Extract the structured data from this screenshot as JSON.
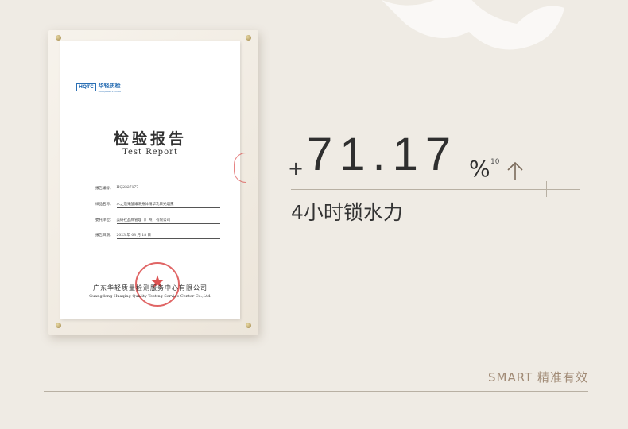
{
  "certificate": {
    "logo_mark": "HQTC",
    "logo_cn": "华轻质检",
    "logo_en": "HUAQING TESTING",
    "title_cn": "检验报告",
    "title_en": "Test Report",
    "fields": [
      {
        "label": "报告编号：",
        "value": "HQ2327177"
      },
      {
        "label": "样品名称：",
        "value": "水之蔻果酸嫩滑身体精华乳日光烟熏"
      },
      {
        "label": "委托单位：",
        "value": "美研社品牌管理（广州）有限公司"
      },
      {
        "label": "报告日期：",
        "value": "2023 年 08 月 18 日"
      }
    ],
    "company_cn": "广东华轻质量检测服务中心有限公司",
    "company_en": "Guangdong Huaqing Quality Testing Service Center Co.,Ltd."
  },
  "stat": {
    "sign": "+",
    "value": "71.17",
    "unit": "%",
    "footnote": "10",
    "trend_icon": "arrow-up-icon",
    "caption": "4小时锁水力"
  },
  "footer": {
    "tagline": "SMART 精准有效"
  },
  "colors": {
    "background": "#efebe4",
    "accent": "#a08a75",
    "text": "#2f2f2f",
    "stamp": "#d63232"
  }
}
